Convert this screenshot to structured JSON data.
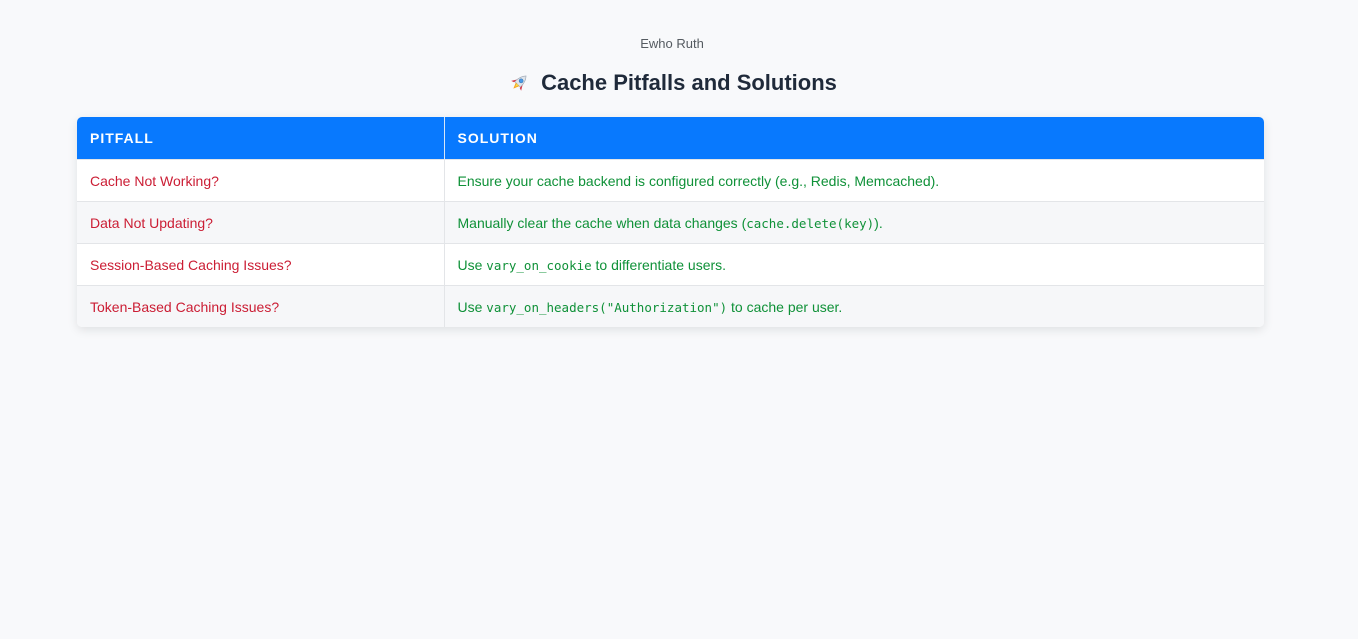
{
  "author": "Ewho Ruth",
  "heading": {
    "icon": "rocket-icon",
    "text": "Cache Pitfalls and Solutions"
  },
  "table": {
    "headers": [
      "PITFALL",
      "SOLUTION"
    ],
    "rows": [
      {
        "pitfall": "Cache Not Working?",
        "solution_pre": "Ensure your cache backend is configured correctly (e.g., Redis, Memcached).",
        "solution_code": "",
        "solution_post": ""
      },
      {
        "pitfall": "Data Not Updating?",
        "solution_pre": "Manually clear the cache when data changes (",
        "solution_code": "cache.delete(key)",
        "solution_post": ")."
      },
      {
        "pitfall": "Session-Based Caching Issues?",
        "solution_pre": "Use ",
        "solution_code": "vary_on_cookie",
        "solution_post": " to differentiate users."
      },
      {
        "pitfall": "Token-Based Caching Issues?",
        "solution_pre": "Use ",
        "solution_code": "vary_on_headers(\"Authorization\")",
        "solution_post": " to cache per user."
      }
    ]
  },
  "colors": {
    "header_bg": "#0879fe",
    "pitfall_text": "#cb1d34",
    "solution_text": "#0f9138"
  }
}
